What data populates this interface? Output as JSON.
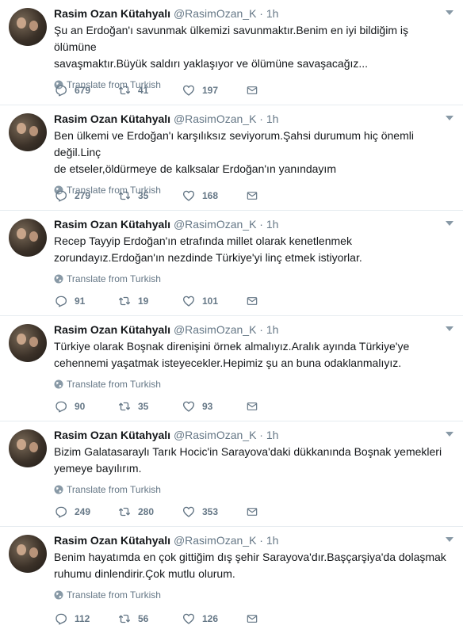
{
  "translate_label": "Translate from Turkish",
  "tweets": [
    {
      "name": "Rasim Ozan Kütahyalı",
      "handle": "@RasimOzan_K",
      "time": "· 1h",
      "lines": [
        "Şu an Erdoğan'ı savunmak ülkemizi savunmaktır.Benim en iyi bildiğim iş ölümüne",
        "savaşmaktır.Büyük saldırı yaklaşıyor ve ölümüne savaşacağız..."
      ],
      "replies": "679",
      "retweets": "41",
      "likes": "197"
    },
    {
      "name": "Rasim Ozan Kütahyalı",
      "handle": "@RasimOzan_K",
      "time": "· 1h",
      "lines": [
        "Ben ülkemi ve Erdoğan'ı karşılıksız seviyorum.Şahsi durumum hiç önemli değil.Linç",
        "de etseler,öldürmeye de kalksalar Erdoğan'ın yanındayım"
      ],
      "replies": "279",
      "retweets": "35",
      "likes": "168"
    },
    {
      "name": "Rasim Ozan Kütahyalı",
      "handle": "@RasimOzan_K",
      "time": "· 1h",
      "lines": [
        "Recep Tayyip Erdoğan'ın etrafında millet olarak kenetlenmek",
        "zorundayız.Erdoğan'ın nezdinde Türkiye'yi linç etmek istiyorlar."
      ],
      "replies": "91",
      "retweets": "19",
      "likes": "101"
    },
    {
      "name": "Rasim Ozan Kütahyalı",
      "handle": "@RasimOzan_K",
      "time": "· 1h",
      "lines": [
        "Türkiye olarak Boşnak direnişini örnek almalıyız.Aralık ayında Türkiye'ye",
        "cehennemi yaşatmak isteyecekler.Hepimiz şu an buna odaklanmalıyız."
      ],
      "replies": "90",
      "retweets": "35",
      "likes": "93"
    },
    {
      "name": "Rasim Ozan Kütahyalı",
      "handle": "@RasimOzan_K",
      "time": "· 1h",
      "lines": [
        "Bizim Galatasaraylı Tarık Hocic'in Sarayova'daki dükkanında Boşnak yemekleri",
        "yemeye bayılırım."
      ],
      "replies": "249",
      "retweets": "280",
      "likes": "353"
    },
    {
      "name": "Rasim Ozan Kütahyalı",
      "handle": "@RasimOzan_K",
      "time": "· 1h",
      "lines": [
        "Benim hayatımda en çok gittiğim dış şehir Sarayova'dır.Başçarşiya'da dolaşmak",
        "ruhumu dinlendirir.Çok mutlu olurum."
      ],
      "replies": "112",
      "retweets": "56",
      "likes": "126"
    }
  ]
}
